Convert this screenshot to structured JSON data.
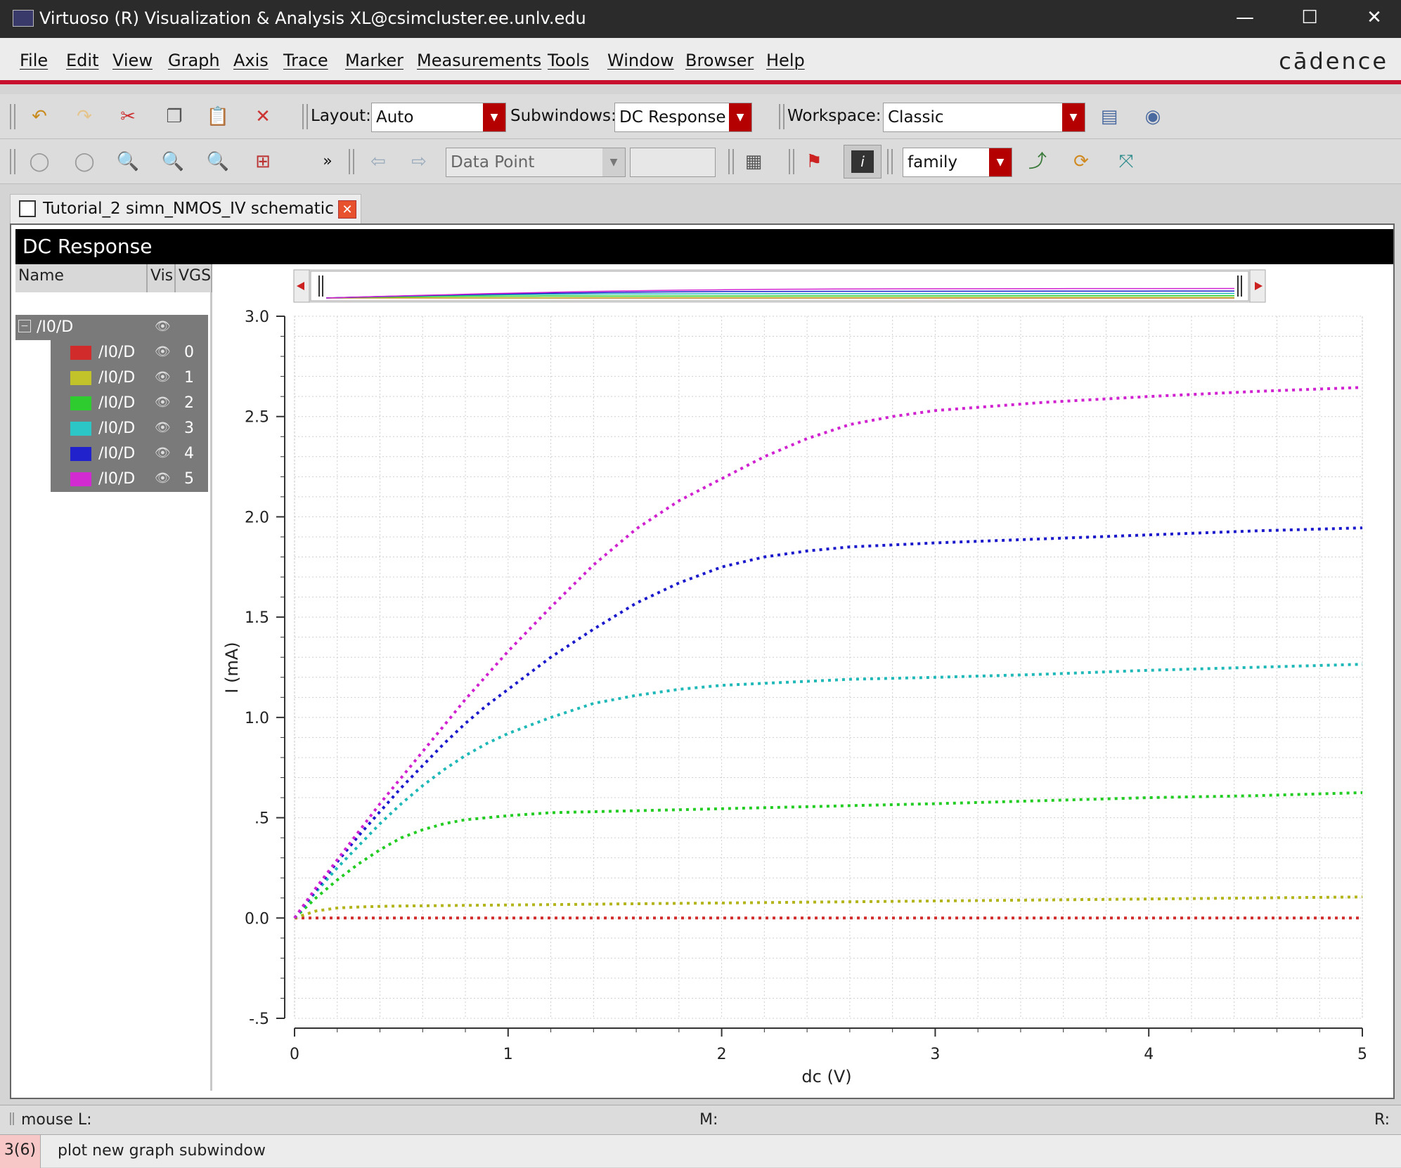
{
  "window": {
    "title": "Virtuoso (R) Visualization & Analysis XL@csimcluster.ee.unlv.edu",
    "minimize": "—",
    "maximize": "☐",
    "close": "✕"
  },
  "menubar": {
    "items": [
      "File",
      "Edit",
      "View",
      "Graph",
      "Axis",
      "Trace",
      "Marker",
      "Measurements",
      "Tools",
      "Window",
      "Browser",
      "Help"
    ],
    "brand": "cādence"
  },
  "toolbar1": {
    "layout_label": "Layout:",
    "layout_value": "Auto",
    "subwindows_label": "Subwindows:",
    "subwindows_value": "DC Response",
    "workspace_label": "Workspace:",
    "workspace_value": "Classic"
  },
  "toolbar2": {
    "more": "»",
    "marker_mode": "Data Point",
    "marker_value": "",
    "view_mode": "family"
  },
  "document_tab": {
    "label": "Tutorial_2 simn_NMOS_IV schematic"
  },
  "subwindow": {
    "title": "DC Response"
  },
  "trace_tree": {
    "columns": [
      "Name",
      "Vis",
      "VGS"
    ],
    "group": "/I0/D",
    "rows": [
      {
        "name": "/I0/D",
        "vgs": "0",
        "color": "#d12b2b"
      },
      {
        "name": "/I0/D",
        "vgs": "1",
        "color": "#c2c22a"
      },
      {
        "name": "/I0/D",
        "vgs": "2",
        "color": "#2ecc2e"
      },
      {
        "name": "/I0/D",
        "vgs": "3",
        "color": "#2cc6c6"
      },
      {
        "name": "/I0/D",
        "vgs": "4",
        "color": "#2222cc"
      },
      {
        "name": "/I0/D",
        "vgs": "5",
        "color": "#d12bd1"
      }
    ]
  },
  "chart_data": {
    "type": "line",
    "xlabel": "dc (V)",
    "ylabel": "I (mA)",
    "xlim": [
      0,
      5
    ],
    "ylim": [
      -0.5,
      3.0
    ],
    "x_ticks": [
      "0",
      "1",
      "2",
      "3",
      "4",
      "5"
    ],
    "y_ticks": [
      "-.5",
      "0.0",
      ".5",
      "1.0",
      "1.5",
      "2.0",
      "2.5",
      "3.0"
    ],
    "grid": true,
    "line_style": "dotted",
    "x": [
      0,
      0.1,
      0.2,
      0.3,
      0.4,
      0.5,
      0.6,
      0.7,
      0.8,
      0.9,
      1.0,
      1.2,
      1.4,
      1.6,
      1.8,
      2.0,
      2.2,
      2.4,
      2.6,
      2.8,
      3.0,
      3.5,
      4.0,
      4.5,
      5.0
    ],
    "series": [
      {
        "name": "0",
        "color": "#d12b2b",
        "values": [
          0,
          0,
          0,
          0,
          0,
          0,
          0,
          0,
          0,
          0,
          0,
          0,
          0,
          0,
          0,
          0,
          0,
          0,
          0,
          0,
          0,
          0,
          0,
          0,
          0
        ]
      },
      {
        "name": "1",
        "color": "#b3b31a",
        "values": [
          0,
          0.035,
          0.05,
          0.055,
          0.058,
          0.06,
          0.061,
          0.062,
          0.063,
          0.064,
          0.065,
          0.067,
          0.069,
          0.071,
          0.073,
          0.075,
          0.077,
          0.079,
          0.081,
          0.083,
          0.085,
          0.09,
          0.095,
          0.1,
          0.105
        ]
      },
      {
        "name": "2",
        "color": "#22cc22",
        "values": [
          0,
          0.1,
          0.19,
          0.27,
          0.34,
          0.4,
          0.44,
          0.47,
          0.49,
          0.5,
          0.51,
          0.525,
          0.53,
          0.535,
          0.54,
          0.545,
          0.55,
          0.555,
          0.56,
          0.565,
          0.57,
          0.585,
          0.6,
          0.61,
          0.625
        ]
      },
      {
        "name": "3",
        "color": "#1fb8b8",
        "values": [
          0,
          0.13,
          0.25,
          0.36,
          0.47,
          0.57,
          0.66,
          0.74,
          0.81,
          0.87,
          0.92,
          1.0,
          1.07,
          1.11,
          1.14,
          1.16,
          1.17,
          1.18,
          1.19,
          1.195,
          1.2,
          1.215,
          1.235,
          1.25,
          1.265
        ]
      },
      {
        "name": "4",
        "color": "#1a1acc",
        "values": [
          0,
          0.14,
          0.28,
          0.41,
          0.53,
          0.65,
          0.76,
          0.87,
          0.97,
          1.06,
          1.14,
          1.3,
          1.44,
          1.57,
          1.67,
          1.75,
          1.8,
          1.83,
          1.85,
          1.86,
          1.87,
          1.89,
          1.91,
          1.93,
          1.945
        ]
      },
      {
        "name": "5",
        "color": "#d022d0",
        "values": [
          0,
          0.15,
          0.29,
          0.43,
          0.57,
          0.7,
          0.83,
          0.96,
          1.09,
          1.21,
          1.33,
          1.55,
          1.76,
          1.94,
          2.08,
          2.19,
          2.3,
          2.39,
          2.46,
          2.5,
          2.53,
          2.57,
          2.6,
          2.625,
          2.645
        ]
      }
    ]
  },
  "status": {
    "mouse_l": "mouse L:",
    "mouse_m": "M:",
    "mouse_r": "R:",
    "count": "3(6)",
    "prompt": "plot new graph subwindow"
  }
}
